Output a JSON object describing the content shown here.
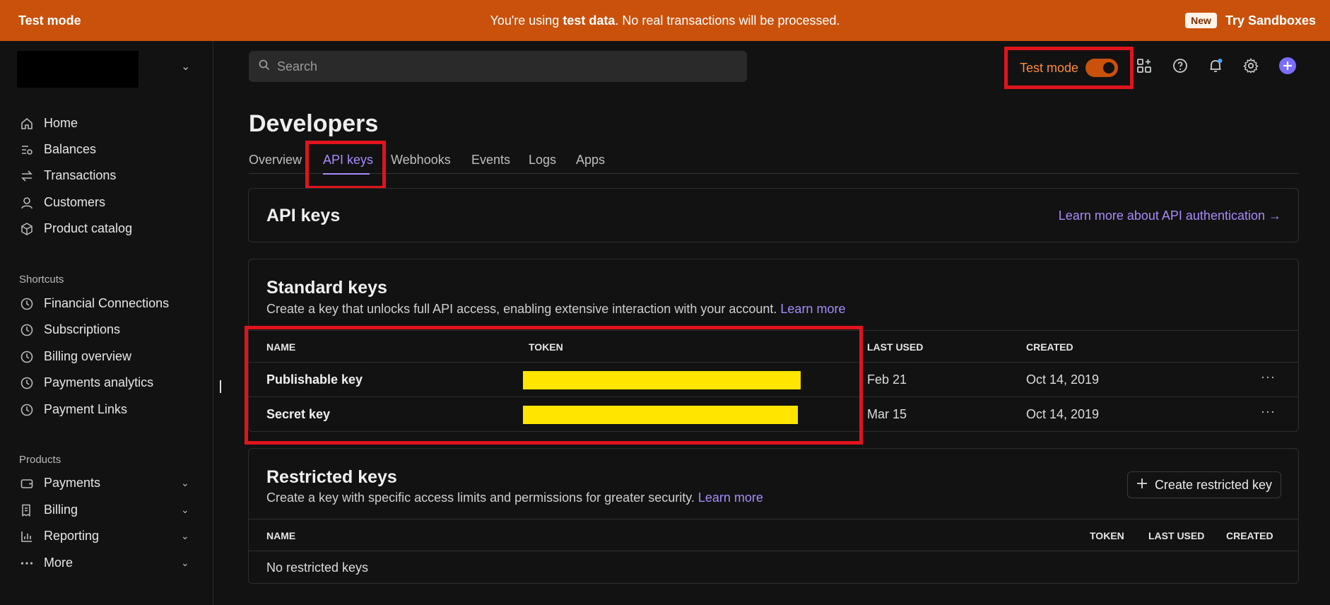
{
  "banner": {
    "mode_label": "Test mode",
    "message_prefix": "You're using ",
    "message_bold": "test data",
    "message_suffix": ". No real transactions will be processed.",
    "new_badge": "New",
    "try_sandboxes": "Try Sandboxes"
  },
  "sidebar": {
    "main_items": [
      {
        "label": "Home",
        "icon": "home-icon"
      },
      {
        "label": "Balances",
        "icon": "balances-icon"
      },
      {
        "label": "Transactions",
        "icon": "transactions-icon"
      },
      {
        "label": "Customers",
        "icon": "customers-icon"
      },
      {
        "label": "Product catalog",
        "icon": "product-catalog-icon"
      }
    ],
    "shortcuts_label": "Shortcuts",
    "shortcuts": [
      {
        "label": "Financial Connections",
        "icon": "clock-icon"
      },
      {
        "label": "Subscriptions",
        "icon": "clock-icon"
      },
      {
        "label": "Billing overview",
        "icon": "clock-icon"
      },
      {
        "label": "Payments analytics",
        "icon": "clock-icon"
      },
      {
        "label": "Payment Links",
        "icon": "clock-icon"
      }
    ],
    "products_label": "Products",
    "products": [
      {
        "label": "Payments",
        "icon": "wallet-icon"
      },
      {
        "label": "Billing",
        "icon": "billing-icon"
      },
      {
        "label": "Reporting",
        "icon": "chart-icon"
      },
      {
        "label": "More",
        "icon": "more-icon"
      }
    ]
  },
  "topbar": {
    "search_placeholder": "Search",
    "test_mode_label": "Test mode",
    "test_mode_on": true
  },
  "page": {
    "title": "Developers",
    "tabs": [
      "Overview",
      "API keys",
      "Webhooks",
      "Events",
      "Logs",
      "Apps"
    ],
    "active_tab": "API keys"
  },
  "api_keys_card": {
    "title": "API keys",
    "learn_more": "Learn more about API authentication →"
  },
  "standard_keys": {
    "title": "Standard keys",
    "description": "Create a key that unlocks full API access, enabling extensive interaction with your account. ",
    "learn_more": "Learn more",
    "columns": [
      "NAME",
      "TOKEN",
      "LAST USED",
      "CREATED"
    ],
    "rows": [
      {
        "name": "Publishable key",
        "last_used": "Feb 21",
        "created": "Oct 14, 2019",
        "menu": "···"
      },
      {
        "name": "Secret key",
        "last_used": "Mar 15",
        "created": "Oct 14, 2019",
        "menu": "···"
      }
    ]
  },
  "restricted_keys": {
    "title": "Restricted keys",
    "description": "Create a key with specific access limits and permissions for greater security. ",
    "learn_more": "Learn more",
    "create_button": "Create restricted key",
    "columns": [
      "NAME",
      "TOKEN",
      "LAST USED",
      "CREATED"
    ],
    "empty_text": "No restricted keys"
  },
  "colors": {
    "banner": "#c9510c",
    "accent": "#a78bfa",
    "highlight_box": "#e0141d",
    "redaction": "#ffe500"
  }
}
